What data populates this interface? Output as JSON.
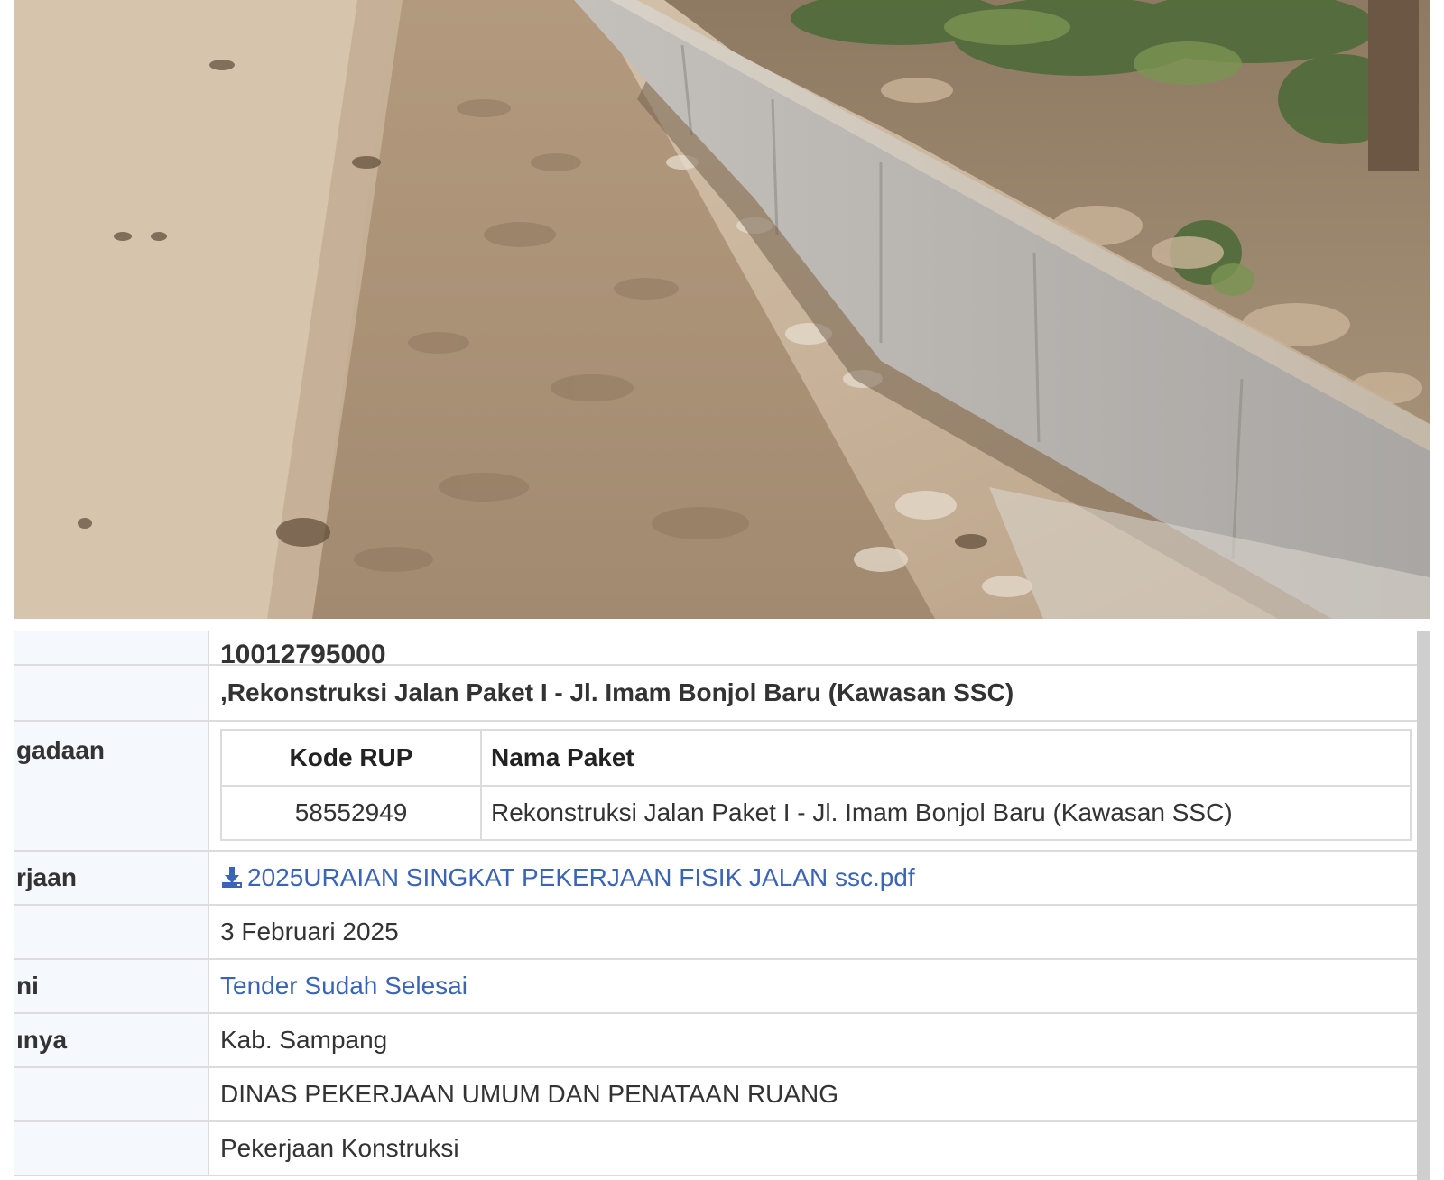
{
  "detail": {
    "partial_value": "10012795000",
    "rows": [
      {
        "label": "",
        "value": ",Rekonstruksi Jalan Paket I - Jl. Imam Bonjol Baru (Kawasan SSC)"
      },
      {
        "label": "gadaan"
      },
      {
        "label": "rjaan",
        "value": "2025URAIAN SINGKAT PEKERJAAN FISIK JALAN ssc.pdf",
        "icon": "download-icon"
      },
      {
        "label": "",
        "value": "3 Februari 2025"
      },
      {
        "label": "ni",
        "value": "Tender Sudah Selesai"
      },
      {
        "label": "ınya",
        "value": "Kab. Sampang"
      },
      {
        "label": "",
        "value": "DINAS PEKERJAAN UMUM DAN PENATAAN RUANG"
      },
      {
        "label": "",
        "value": "Pekerjaan Konstruksi"
      }
    ],
    "rup_table": {
      "headers": [
        "Kode RUP",
        "Nama Paket"
      ],
      "rows": [
        {
          "kode": "58552949",
          "nama": "Rekonstruksi Jalan Paket I - Jl. Imam Bonjol Baru (Kawasan SSC)"
        }
      ]
    }
  },
  "colors": {
    "link": "#3a64b8",
    "label_bg": "#f5f8fd",
    "border": "#dcdcdc"
  }
}
